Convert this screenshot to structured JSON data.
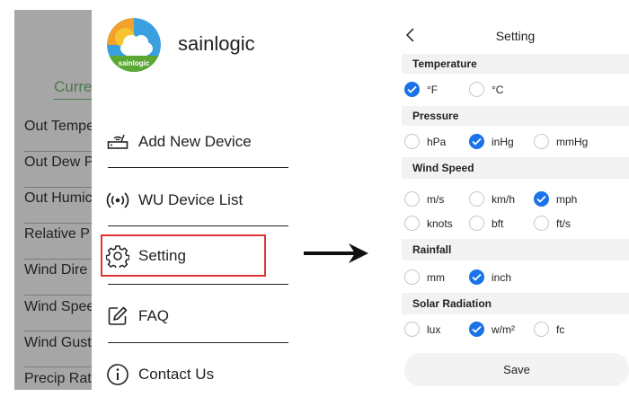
{
  "background_screen": {
    "current_label": "Curre",
    "rows": [
      "Out Tempe",
      "Out Dew P",
      "Out Humic",
      "Relative P",
      "Wind Dire",
      "Wind Spee",
      "Wind Gust",
      "Precip Rat"
    ]
  },
  "drawer": {
    "app_name": "sainlogic",
    "logo_text": "sainlogic",
    "menu": {
      "add_device": "Add New Device",
      "wu_device_list": "WU Device List",
      "setting": "Setting",
      "faq": "FAQ",
      "contact": "Contact Us"
    }
  },
  "settings": {
    "title": "Setting",
    "save_label": "Save",
    "temperature": {
      "title": "Temperature",
      "options": [
        "°F",
        "°C"
      ],
      "selected": "°F"
    },
    "pressure": {
      "title": "Pressure",
      "options": [
        "hPa",
        "inHg",
        "mmHg"
      ],
      "selected": "inHg"
    },
    "wind_speed": {
      "title": "Wind Speed",
      "options": [
        "m/s",
        "km/h",
        "mph",
        "knots",
        "bft",
        "ft/s"
      ],
      "selected": "mph"
    },
    "rainfall": {
      "title": "Rainfall",
      "options": [
        "mm",
        "inch"
      ],
      "selected": "inch"
    },
    "solar_radiation": {
      "title": "Solar Radiation",
      "options": [
        "lux",
        "w/m²",
        "fc"
      ],
      "selected": "w/m²"
    }
  },
  "colors": {
    "accent": "#1a73e8",
    "highlight_border": "#e03333",
    "overlay_gray": "#a6a6a6"
  }
}
